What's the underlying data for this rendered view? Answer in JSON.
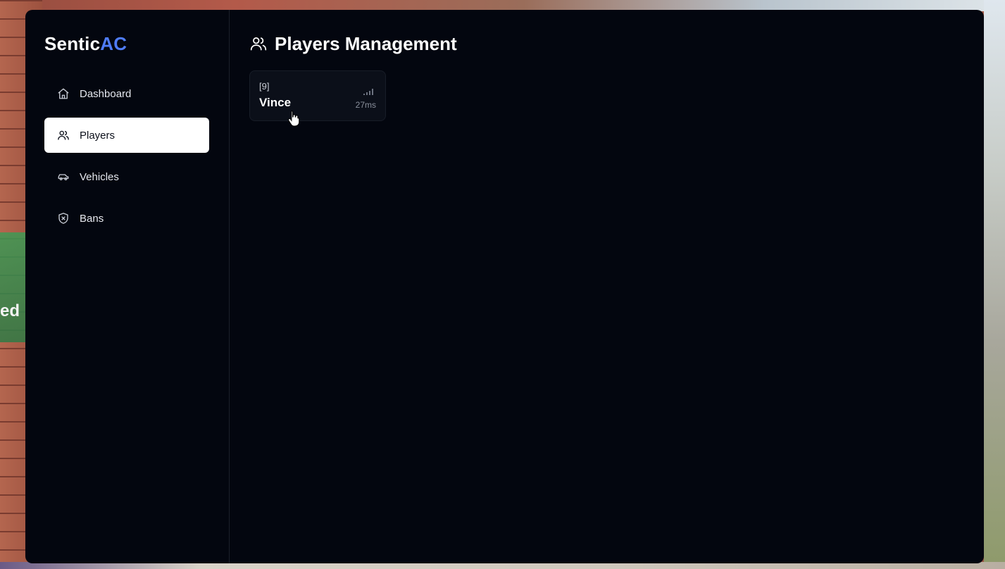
{
  "background": {
    "partial_text": "ed"
  },
  "app": {
    "brand_main": "Sentic",
    "brand_accent": "AC",
    "accent_color": "#4f7cf7"
  },
  "sidebar": {
    "items": [
      {
        "label": "Dashboard",
        "icon": "home-icon",
        "active": false
      },
      {
        "label": "Players",
        "icon": "users-icon",
        "active": true
      },
      {
        "label": "Vehicles",
        "icon": "car-icon",
        "active": false
      },
      {
        "label": "Bans",
        "icon": "shield-x-icon",
        "active": false
      }
    ]
  },
  "main": {
    "title": "Players Management",
    "title_icon": "users-icon",
    "players": [
      {
        "id": "[9]",
        "name": "Vince",
        "ping": "27ms",
        "signal_icon": "signal-icon"
      }
    ]
  }
}
